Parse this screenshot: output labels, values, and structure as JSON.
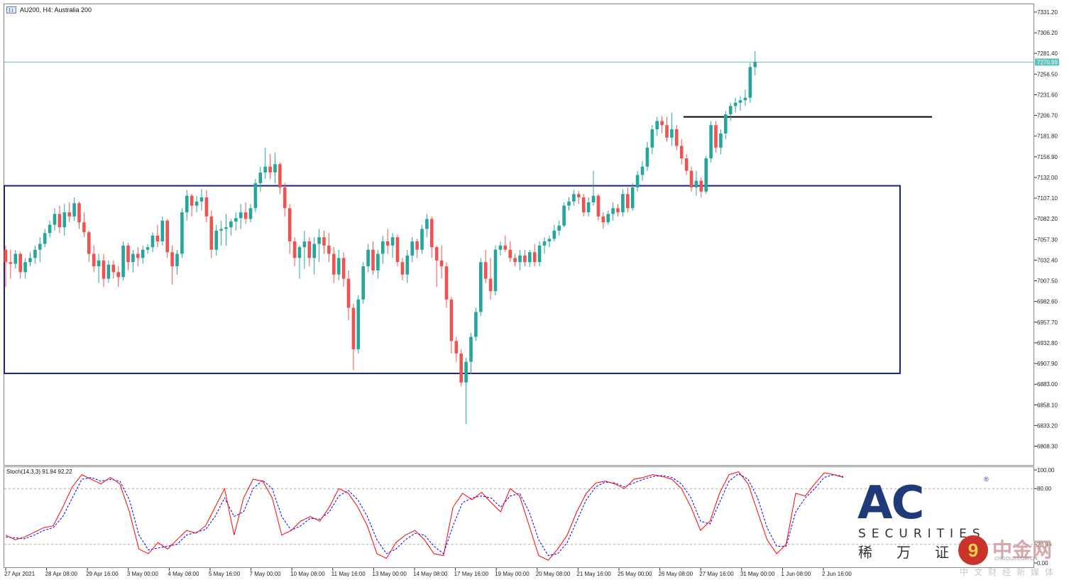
{
  "title": "AU200, H4:  Australia 200",
  "indicator_label": "Stoch(14,3,3) 91.94 92.22",
  "colors": {
    "bull": "#26a69a",
    "bear": "#ef5350",
    "range_box": "#1a237e",
    "resistance": "#000000",
    "price_line": "#5bc0be",
    "stoch_main": "#ff0000",
    "stoch_signal": "#0000ff"
  },
  "price_axis_labels": [
    "7331.20",
    "7306.20",
    "7281.40",
    "7256.50",
    "7231.60",
    "7206.70",
    "7181.80",
    "7156.90",
    "7132.00",
    "7107.10",
    "7082.20",
    "7057.30",
    "7032.40",
    "7007.50",
    "6982.60",
    "6957.70",
    "6932.80",
    "6907.90",
    "6883.00",
    "6858.10",
    "6833.20",
    "6808.30"
  ],
  "current_price": "7270.99",
  "stoch_axis_labels": [
    "100.00",
    "80.00",
    "20.00",
    "0.00"
  ],
  "time_labels": [
    "27 Apr 2021",
    "28 Apr 08:00",
    "29 Apr 16:00",
    "3 May 00:00",
    "4 May 08:00",
    "5 May 16:00",
    "7 May 00:00",
    "10 May 08:00",
    "11 May 16:00",
    "13 May 00:00",
    "14 May 08:00",
    "17 May 16:00",
    "19 May 00:00",
    "20 May 08:00",
    "21 May 16:00",
    "25 May 00:00",
    "26 May 08:00",
    "27 May 16:00",
    "31 May 00:00",
    "1 Jun 08:00",
    "2 Jun 16:00"
  ],
  "logo": {
    "brand": "AC",
    "reg": "®",
    "securities": "SECURITIES",
    "chinese": "稀万证",
    "cngold_glyph": "9",
    "cngold_name": "中金网",
    "cngold_url": "CNGOLD.COM.CN",
    "cngold_sub": "中文财经新媒体"
  },
  "chart_data": {
    "type": "candlestick",
    "symbol": "AU200",
    "timeframe": "H4",
    "ylim": [
      6795,
      7340
    ],
    "current_price": 7270.99,
    "range_box": {
      "low": 6896,
      "high": 7122
    },
    "resistance_level": 7205,
    "candles": [
      [
        7045,
        7050,
        7000,
        7030
      ],
      [
        7030,
        7045,
        7010,
        7028
      ],
      [
        7028,
        7045,
        7022,
        7040
      ],
      [
        7040,
        7042,
        7010,
        7018
      ],
      [
        7018,
        7035,
        7010,
        7030
      ],
      [
        7030,
        7042,
        7025,
        7035
      ],
      [
        7035,
        7050,
        7028,
        7045
      ],
      [
        7045,
        7060,
        7030,
        7052
      ],
      [
        7052,
        7070,
        7048,
        7065
      ],
      [
        7065,
        7080,
        7060,
        7075
      ],
      [
        7075,
        7095,
        7068,
        7088
      ],
      [
        7088,
        7098,
        7065,
        7072
      ],
      [
        7072,
        7100,
        7062,
        7090
      ],
      [
        7090,
        7102,
        7078,
        7085
      ],
      [
        7085,
        7108,
        7080,
        7101
      ],
      [
        7101,
        7103,
        7070,
        7078
      ],
      [
        7078,
        7090,
        7060,
        7066
      ],
      [
        7066,
        7068,
        7030,
        7040
      ],
      [
        7040,
        7050,
        7018,
        7025
      ],
      [
        7025,
        7040,
        7005,
        7032
      ],
      [
        7032,
        7040,
        7000,
        7010
      ],
      [
        7010,
        7032,
        7005,
        7027
      ],
      [
        7027,
        7032,
        7010,
        7018
      ],
      [
        7018,
        7025,
        7000,
        7012
      ],
      [
        7012,
        7055,
        7008,
        7050
      ],
      [
        7050,
        7053,
        7020,
        7030
      ],
      [
        7030,
        7045,
        7018,
        7040
      ],
      [
        7040,
        7048,
        7025,
        7035
      ],
      [
        7035,
        7050,
        7028,
        7045
      ],
      [
        7045,
        7052,
        7040,
        7048
      ],
      [
        7048,
        7066,
        7042,
        7062
      ],
      [
        7062,
        7075,
        7048,
        7055
      ],
      [
        7055,
        7085,
        7050,
        7080
      ],
      [
        7080,
        7082,
        7035,
        7042
      ],
      [
        7042,
        7050,
        7003,
        7025
      ],
      [
        7025,
        7045,
        7015,
        7040
      ],
      [
        7040,
        7095,
        7035,
        7090
      ],
      [
        7090,
        7117,
        7080,
        7110
      ],
      [
        7110,
        7112,
        7085,
        7098
      ],
      [
        7098,
        7110,
        7090,
        7103
      ],
      [
        7103,
        7118,
        7092,
        7108
      ],
      [
        7108,
        7117,
        7078,
        7085
      ],
      [
        7085,
        7092,
        7035,
        7045
      ],
      [
        7045,
        7075,
        7038,
        7068
      ],
      [
        7068,
        7080,
        7050,
        7070
      ],
      [
        7070,
        7088,
        7050,
        7072
      ],
      [
        7072,
        7082,
        7062,
        7079
      ],
      [
        7079,
        7090,
        7068,
        7083
      ],
      [
        7083,
        7100,
        7070,
        7090
      ],
      [
        7090,
        7102,
        7076,
        7082
      ],
      [
        7082,
        7100,
        7078,
        7095
      ],
      [
        7095,
        7130,
        7090,
        7125
      ],
      [
        7125,
        7145,
        7115,
        7138
      ],
      [
        7138,
        7168,
        7130,
        7145
      ],
      [
        7145,
        7160,
        7130,
        7138
      ],
      [
        7138,
        7162,
        7125,
        7148
      ],
      [
        7148,
        7150,
        7112,
        7120
      ],
      [
        7120,
        7125,
        7085,
        7095
      ],
      [
        7095,
        7100,
        7040,
        7055
      ],
      [
        7055,
        7060,
        7025,
        7035
      ],
      [
        7035,
        7050,
        7010,
        7048
      ],
      [
        7048,
        7068,
        7022,
        7055
      ],
      [
        7055,
        7060,
        7025,
        7035
      ],
      [
        7035,
        7060,
        7015,
        7052
      ],
      [
        7052,
        7070,
        7030,
        7060
      ],
      [
        7060,
        7068,
        7040,
        7050
      ],
      [
        7050,
        7065,
        7030,
        7040
      ],
      [
        7040,
        7048,
        7005,
        7015
      ],
      [
        7015,
        7045,
        7008,
        7035
      ],
      [
        7035,
        7042,
        7000,
        7010
      ],
      [
        7010,
        7020,
        6960,
        6975
      ],
      [
        6975,
        6980,
        6900,
        6925
      ],
      [
        6925,
        6990,
        6920,
        6985
      ],
      [
        6985,
        7030,
        6980,
        7025
      ],
      [
        7025,
        7052,
        7018,
        7045
      ],
      [
        7045,
        7055,
        7015,
        7020
      ],
      [
        7020,
        7045,
        7010,
        7040
      ],
      [
        7040,
        7062,
        7028,
        7055
      ],
      [
        7055,
        7070,
        7040,
        7050
      ],
      [
        7050,
        7065,
        7035,
        7060
      ],
      [
        7060,
        7063,
        7025,
        7030
      ],
      [
        7030,
        7035,
        7008,
        7015
      ],
      [
        7015,
        7045,
        7005,
        7038
      ],
      [
        7038,
        7060,
        7030,
        7055
      ],
      [
        7055,
        7058,
        7035,
        7045
      ],
      [
        7045,
        7075,
        7040,
        7070
      ],
      [
        7070,
        7088,
        7060,
        7082
      ],
      [
        7082,
        7085,
        7035,
        7048
      ],
      [
        7048,
        7050,
        7000,
        7032
      ],
      [
        7032,
        7050,
        7010,
        7025
      ],
      [
        7025,
        7030,
        6975,
        6985
      ],
      [
        6985,
        6988,
        6920,
        6935
      ],
      [
        6935,
        6940,
        6910,
        6920
      ],
      [
        6920,
        6925,
        6880,
        6885
      ],
      [
        6885,
        6915,
        6835,
        6910
      ],
      [
        6910,
        6945,
        6895,
        6940
      ],
      [
        6940,
        6975,
        6935,
        6970
      ],
      [
        6970,
        7035,
        6965,
        7030
      ],
      [
        7030,
        7045,
        7005,
        7010
      ],
      [
        7010,
        7035,
        6985,
        6995
      ],
      [
        6995,
        7050,
        6990,
        7045
      ],
      [
        7045,
        7055,
        7038,
        7050
      ],
      [
        7050,
        7062,
        7042,
        7045
      ],
      [
        7045,
        7055,
        7030,
        7035
      ],
      [
        7035,
        7040,
        7025,
        7030
      ],
      [
        7030,
        7045,
        7020,
        7038
      ],
      [
        7038,
        7045,
        7025,
        7030
      ],
      [
        7030,
        7045,
        7024,
        7042
      ],
      [
        7042,
        7052,
        7025,
        7030
      ],
      [
        7030,
        7055,
        7025,
        7050
      ],
      [
        7050,
        7060,
        7040,
        7055
      ],
      [
        7055,
        7062,
        7048,
        7058
      ],
      [
        7058,
        7075,
        7055,
        7068
      ],
      [
        7068,
        7080,
        7062,
        7074
      ],
      [
        7074,
        7102,
        7072,
        7098
      ],
      [
        7098,
        7108,
        7092,
        7103
      ],
      [
        7103,
        7117,
        7098,
        7112
      ],
      [
        7112,
        7116,
        7100,
        7108
      ],
      [
        7108,
        7112,
        7085,
        7090
      ],
      [
        7090,
        7108,
        7085,
        7102
      ],
      [
        7102,
        7140,
        7098,
        7110
      ],
      [
        7110,
        7112,
        7080,
        7085
      ],
      [
        7085,
        7090,
        7070,
        7078
      ],
      [
        7078,
        7092,
        7075,
        7088
      ],
      [
        7088,
        7102,
        7080,
        7095
      ],
      [
        7095,
        7100,
        7085,
        7090
      ],
      [
        7090,
        7118,
        7085,
        7112
      ],
      [
        7112,
        7120,
        7090,
        7095
      ],
      [
        7095,
        7125,
        7092,
        7120
      ],
      [
        7120,
        7140,
        7115,
        7135
      ],
      [
        7135,
        7152,
        7128,
        7145
      ],
      [
        7145,
        7175,
        7140,
        7168
      ],
      [
        7168,
        7195,
        7160,
        7190
      ],
      [
        7190,
        7205,
        7182,
        7200
      ],
      [
        7200,
        7206,
        7185,
        7195
      ],
      [
        7195,
        7205,
        7175,
        7180
      ],
      [
        7180,
        7210,
        7170,
        7190
      ],
      [
        7190,
        7195,
        7165,
        7170
      ],
      [
        7170,
        7178,
        7148,
        7155
      ],
      [
        7155,
        7160,
        7135,
        7140
      ],
      [
        7140,
        7145,
        7115,
        7120
      ],
      [
        7120,
        7140,
        7110,
        7128
      ],
      [
        7128,
        7132,
        7108,
        7115
      ],
      [
        7115,
        7158,
        7112,
        7155
      ],
      [
        7155,
        7200,
        7150,
        7195
      ],
      [
        7195,
        7200,
        7162,
        7168
      ],
      [
        7168,
        7190,
        7160,
        7185
      ],
      [
        7185,
        7212,
        7178,
        7208
      ],
      [
        7208,
        7222,
        7200,
        7218
      ],
      [
        7218,
        7228,
        7210,
        7222
      ],
      [
        7222,
        7230,
        7212,
        7225
      ],
      [
        7225,
        7238,
        7218,
        7228
      ],
      [
        7228,
        7270,
        7222,
        7265
      ],
      [
        7265,
        7284,
        7255,
        7271
      ]
    ],
    "stochastic": {
      "params": "14,3,3",
      "main": 91.94,
      "signal": 92.22,
      "levels": [
        80,
        20
      ],
      "ylim": [
        0,
        100
      ],
      "main_series": [
        30,
        25,
        28,
        33,
        38,
        40,
        60,
        82,
        95,
        90,
        85,
        92,
        85,
        55,
        15,
        10,
        22,
        15,
        25,
        35,
        32,
        40,
        60,
        80,
        30,
        70,
        90,
        88,
        70,
        30,
        35,
        45,
        50,
        45,
        60,
        80,
        75,
        60,
        40,
        10,
        5,
        22,
        30,
        35,
        25,
        10,
        8,
        60,
        75,
        68,
        76,
        65,
        55,
        80,
        72,
        40,
        8,
        3,
        15,
        30,
        55,
        75,
        86,
        88,
        85,
        80,
        90,
        92,
        95,
        93,
        90,
        80,
        60,
        35,
        45,
        75,
        95,
        98,
        85,
        55,
        25,
        10,
        20,
        75,
        72,
        85,
        97,
        95,
        92
      ],
      "signal_series": [
        28,
        27,
        26,
        30,
        35,
        38,
        50,
        70,
        90,
        92,
        88,
        90,
        88,
        68,
        30,
        14,
        16,
        18,
        20,
        30,
        33,
        36,
        50,
        70,
        50,
        55,
        80,
        89,
        80,
        50,
        35,
        40,
        48,
        47,
        55,
        72,
        78,
        68,
        50,
        25,
        10,
        15,
        25,
        32,
        30,
        18,
        10,
        40,
        65,
        70,
        72,
        70,
        60,
        72,
        75,
        55,
        25,
        8,
        10,
        22,
        45,
        68,
        82,
        87,
        86,
        82,
        86,
        90,
        93,
        94,
        92,
        85,
        70,
        45,
        42,
        65,
        88,
        96,
        90,
        70,
        38,
        18,
        18,
        55,
        70,
        80,
        92,
        95,
        93
      ]
    }
  }
}
